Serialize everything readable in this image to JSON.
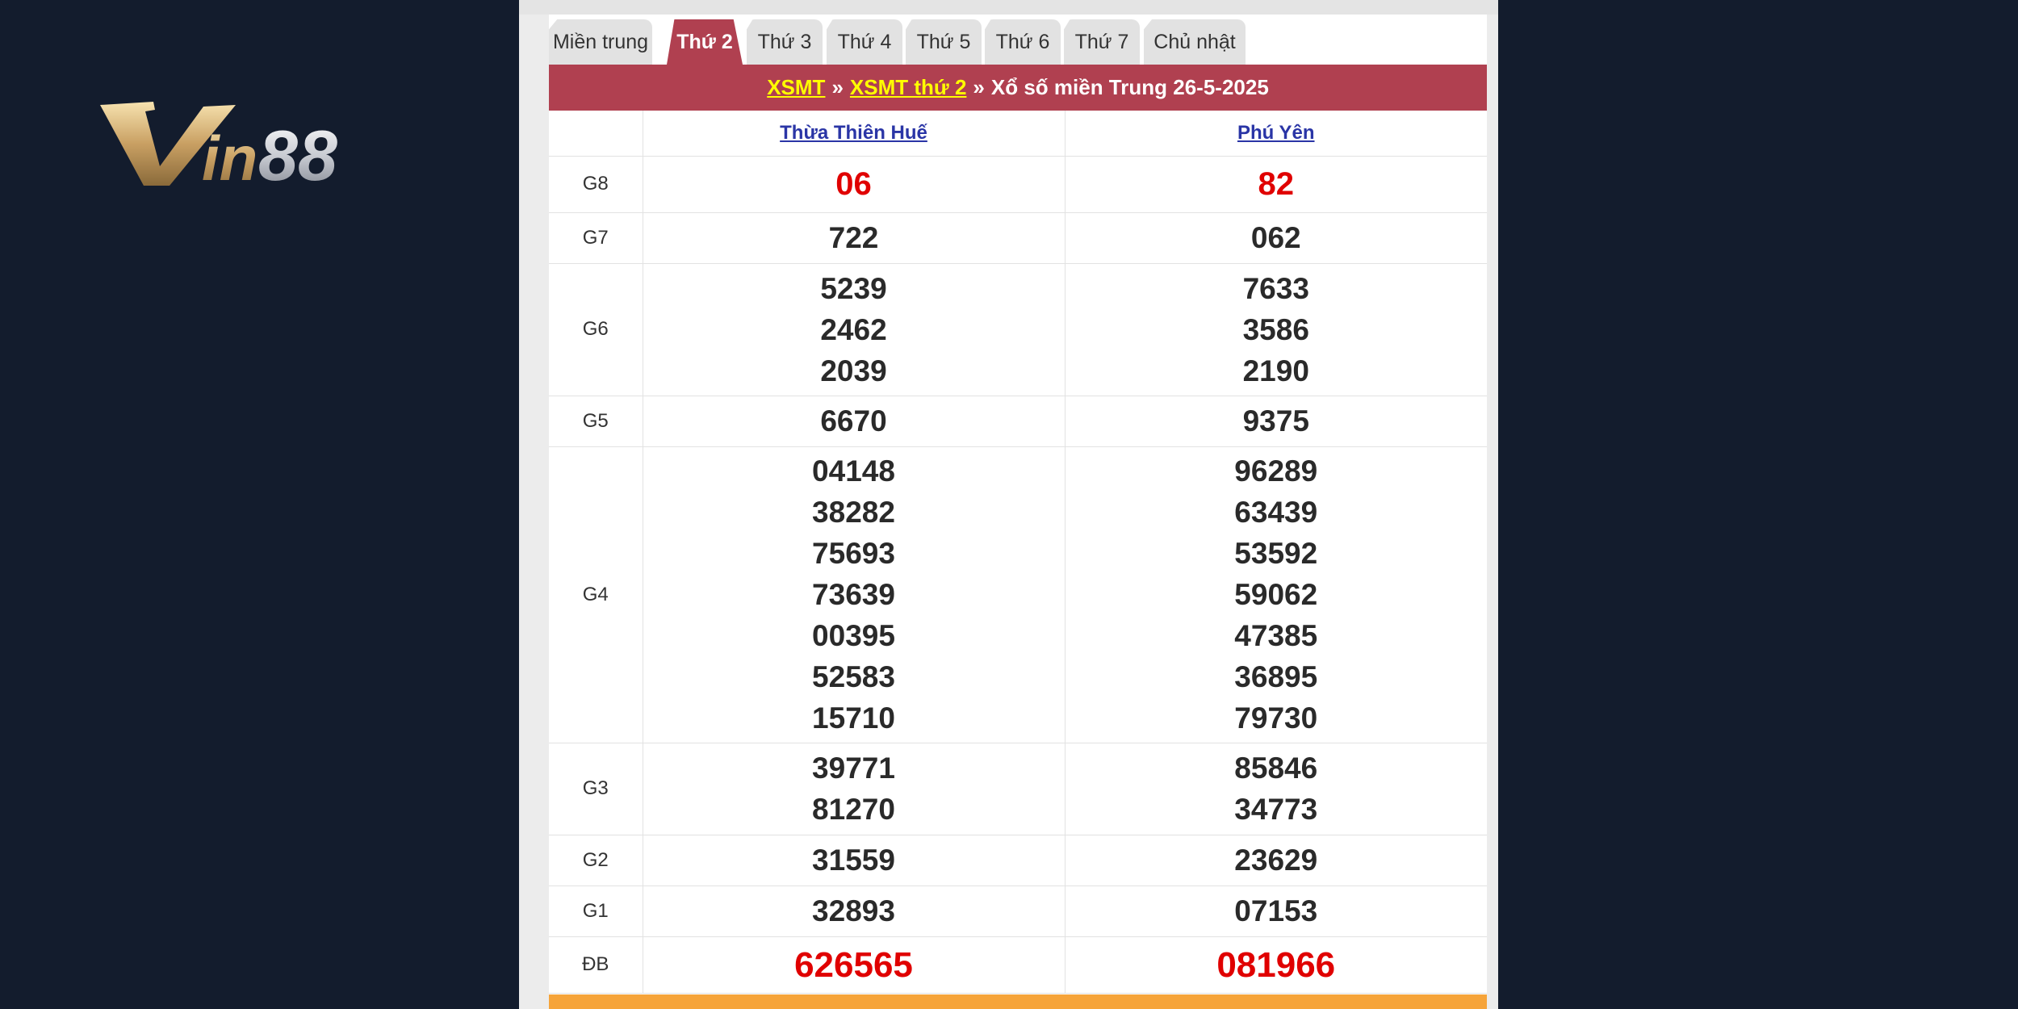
{
  "logo": {
    "text": "Vin88"
  },
  "tabs": [
    {
      "label": "Miền trung",
      "active": false
    },
    {
      "label": "Thứ 2",
      "active": true
    },
    {
      "label": "Thứ 3",
      "active": false
    },
    {
      "label": "Thứ 4",
      "active": false
    },
    {
      "label": "Thứ 5",
      "active": false
    },
    {
      "label": "Thứ 6",
      "active": false
    },
    {
      "label": "Thứ 7",
      "active": false
    },
    {
      "label": "Chủ nhật",
      "active": false
    }
  ],
  "title": {
    "link1": "XSMT",
    "sep1": "»",
    "link2": "XSMT thứ 2",
    "sep2": "»",
    "text": "Xổ số miền Trung 26-5-2025"
  },
  "provinces": [
    "Thừa Thiên Huế",
    "Phú Yên"
  ],
  "prizes": {
    "g8": {
      "label": "G8",
      "hue": [
        "06"
      ],
      "phuyen": [
        "82"
      ]
    },
    "g7": {
      "label": "G7",
      "hue": [
        "722"
      ],
      "phuyen": [
        "062"
      ]
    },
    "g6": {
      "label": "G6",
      "hue": [
        "5239",
        "2462",
        "2039"
      ],
      "phuyen": [
        "7633",
        "3586",
        "2190"
      ]
    },
    "g5": {
      "label": "G5",
      "hue": [
        "6670"
      ],
      "phuyen": [
        "9375"
      ]
    },
    "g4": {
      "label": "G4",
      "hue": [
        "04148",
        "38282",
        "75693",
        "73639",
        "00395",
        "52583",
        "15710"
      ],
      "phuyen": [
        "96289",
        "63439",
        "53592",
        "59062",
        "47385",
        "36895",
        "79730"
      ]
    },
    "g3": {
      "label": "G3",
      "hue": [
        "39771",
        "81270"
      ],
      "phuyen": [
        "85846",
        "34773"
      ]
    },
    "g2": {
      "label": "G2",
      "hue": [
        "31559"
      ],
      "phuyen": [
        "23629"
      ]
    },
    "g1": {
      "label": "G1",
      "hue": [
        "32893"
      ],
      "phuyen": [
        "07153"
      ]
    },
    "db": {
      "label": "ĐB",
      "hue": [
        "626565"
      ],
      "phuyen": [
        "081966"
      ]
    }
  },
  "colors": {
    "accent": "#b04050",
    "link_yellow": "#ffff00",
    "prize_red": "#e00000",
    "bar_orange": "#f6a43a",
    "background": "#131c2d"
  }
}
